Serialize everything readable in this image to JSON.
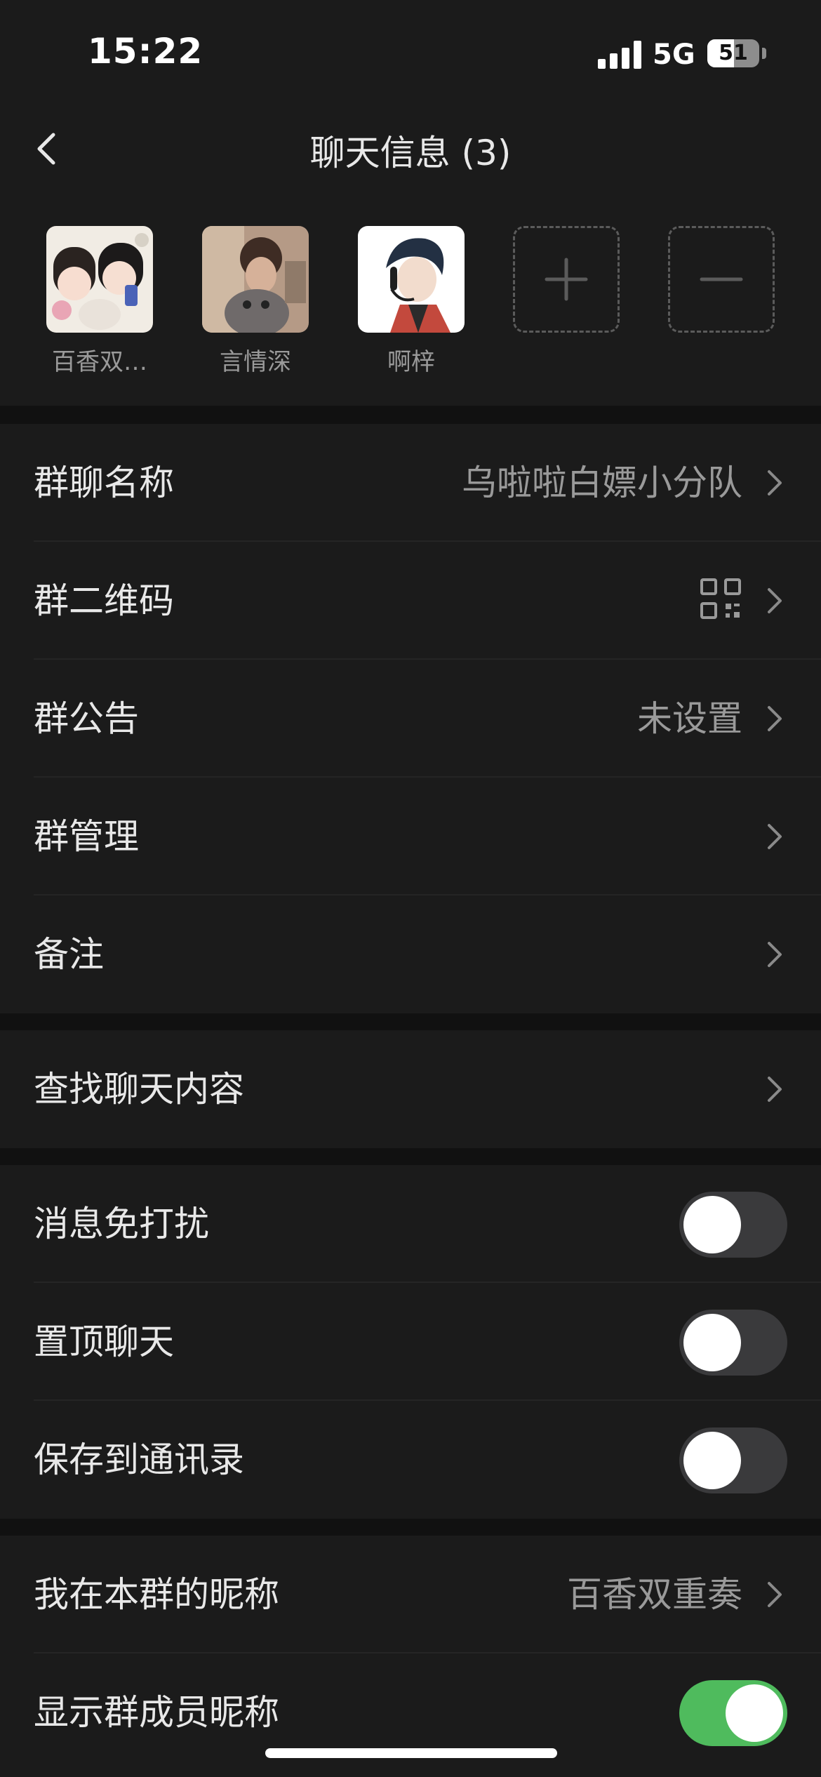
{
  "status_bar": {
    "time": "15:22",
    "network": "5G",
    "battery": "51",
    "battery_level": 0.51
  },
  "header": {
    "title": "聊天信息 (3)"
  },
  "members": [
    {
      "name": "百香双…"
    },
    {
      "name": "言情深"
    },
    {
      "name": "啊梓"
    }
  ],
  "group_info": {
    "name_label": "群聊名称",
    "name_value": "乌啦啦白嫖小分队",
    "qr_label": "群二维码",
    "notice_label": "群公告",
    "notice_value": "未设置",
    "manage_label": "群管理",
    "remark_label": "备注"
  },
  "search": {
    "label": "查找聊天内容"
  },
  "toggles": {
    "mute_label": "消息免打扰",
    "mute_on": false,
    "pin_label": "置顶聊天",
    "pin_on": false,
    "save_label": "保存到通讯录",
    "save_on": false
  },
  "nickname": {
    "label": "我在本群的昵称",
    "value": "百香双重奏",
    "show_label": "显示群成员昵称",
    "show_on": true
  },
  "colors": {
    "background": "#111111",
    "row_background": "#1b1b1b",
    "accent_green": "#4fbb5d"
  }
}
